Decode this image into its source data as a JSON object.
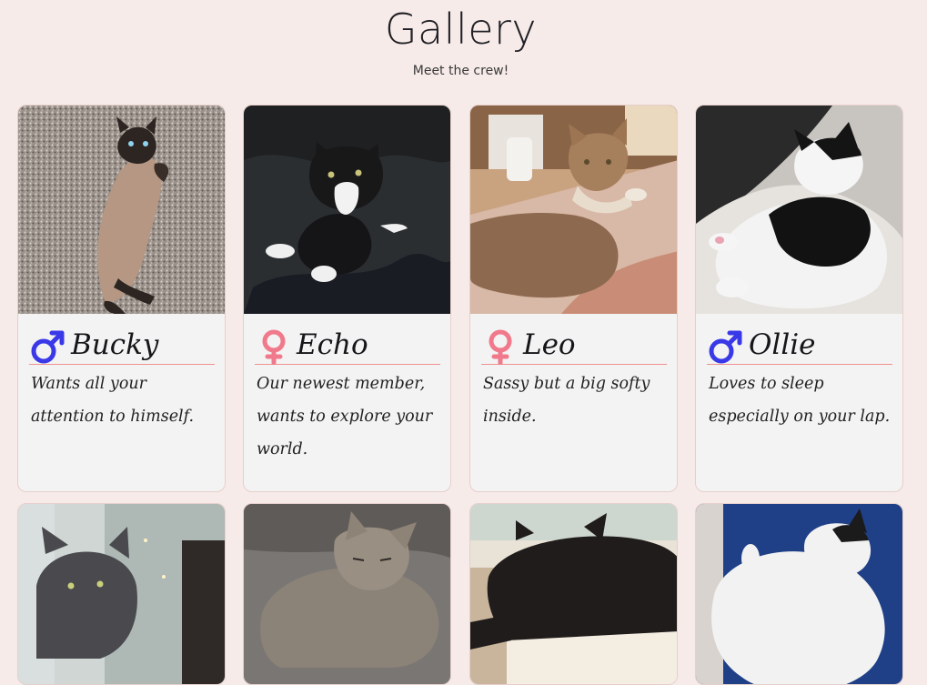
{
  "header": {
    "title": "Gallery",
    "subtitle": "Meet the crew!"
  },
  "colors": {
    "background": "#f6ebe9",
    "card": "#f4f3f3",
    "male": "#3a39e8",
    "female": "#f07a8c",
    "divider": "#ef8f8f"
  },
  "cats": [
    {
      "name": "Bucky",
      "gender": "male",
      "icon": "male-symbol-icon",
      "description": "Wants all your attention to himself."
    },
    {
      "name": "Echo",
      "gender": "female",
      "icon": "female-symbol-icon",
      "description": "Our newest member, wants to explore your world."
    },
    {
      "name": "Leo",
      "gender": "female",
      "icon": "female-symbol-icon",
      "description": "Sassy but a big softy inside."
    },
    {
      "name": "Ollie",
      "gender": "male",
      "icon": "male-symbol-icon",
      "description": "Loves to sleep especially on your lap."
    },
    {
      "name": "",
      "gender": "",
      "icon": "",
      "description": ""
    },
    {
      "name": "",
      "gender": "",
      "icon": "",
      "description": ""
    },
    {
      "name": "",
      "gender": "",
      "icon": "",
      "description": ""
    },
    {
      "name": "",
      "gender": "",
      "icon": "",
      "description": ""
    }
  ]
}
